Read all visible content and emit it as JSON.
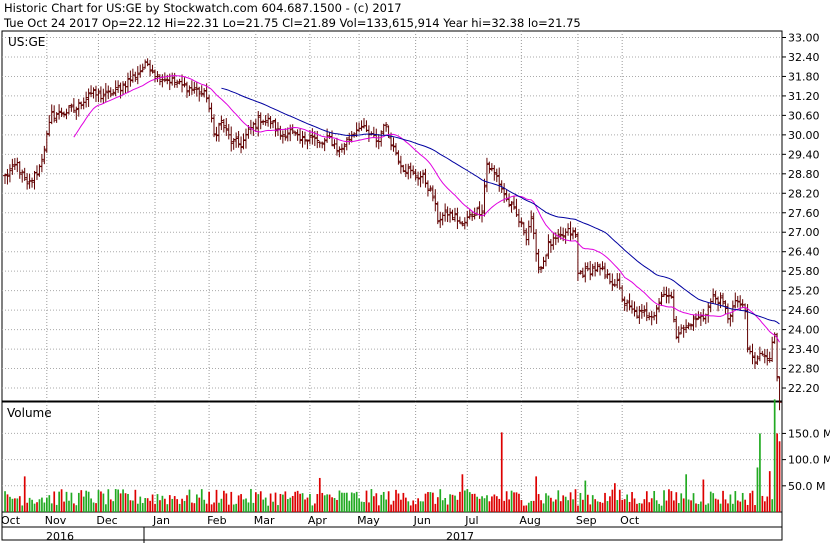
{
  "header": {
    "line1": "Historic Chart for US:GE by Stockwatch.com 604.687.1500 - (c) 2017",
    "line2": "Tue Oct 24 2017   Op=22.12   Hi=22.31   Lo=21.75   Cl=21.89   Vol=133,615,914   Year hi=32.38   lo=21.75"
  },
  "chart_data": {
    "type": "ohlc-bar",
    "symbol": "US:GE",
    "price_axis": {
      "min": 21.8,
      "max": 33.2,
      "ticks": [
        "33.00",
        "32.40",
        "31.80",
        "31.20",
        "30.60",
        "30.00",
        "29.40",
        "28.80",
        "28.20",
        "27.60",
        "27.00",
        "26.40",
        "25.80",
        "25.20",
        "24.60",
        "24.00",
        "23.40",
        "22.80",
        "22.20"
      ]
    },
    "volume_panel": {
      "label": "Volume",
      "ticks": [
        "150.0",
        "100.0",
        "50.0"
      ],
      "max_millions": 210
    },
    "months": [
      "Oct",
      "Nov",
      "Dec",
      "Jan",
      "Feb",
      "Mar",
      "Apr",
      "May",
      "Jun",
      "Jul",
      "Aug",
      "Sep",
      "Oct"
    ],
    "years": [
      "2016",
      "2017"
    ],
    "colors": {
      "ma_short": "#e000e0",
      "ma_long": "#0000a0",
      "bars": "#600000",
      "vol_up": "#22aa22",
      "vol_down": "#dd0000"
    },
    "close_anchors": [
      [
        0,
        28.7
      ],
      [
        5,
        29.1
      ],
      [
        9,
        28.4
      ],
      [
        14,
        29.0
      ],
      [
        19,
        30.6
      ],
      [
        24,
        30.7
      ],
      [
        29,
        30.8
      ],
      [
        34,
        31.3
      ],
      [
        39,
        31.2
      ],
      [
        44,
        31.3
      ],
      [
        49,
        31.6
      ],
      [
        54,
        31.9
      ],
      [
        58,
        32.2
      ],
      [
        62,
        31.8
      ],
      [
        67,
        31.7
      ],
      [
        72,
        31.5
      ],
      [
        77,
        31.4
      ],
      [
        82,
        31.2
      ],
      [
        85,
        30.0
      ],
      [
        88,
        30.4
      ],
      [
        92,
        29.8
      ],
      [
        96,
        29.7
      ],
      [
        100,
        30.2
      ],
      [
        104,
        30.5
      ],
      [
        108,
        30.4
      ],
      [
        112,
        30.0
      ],
      [
        116,
        30.1
      ],
      [
        120,
        29.8
      ],
      [
        124,
        30.0
      ],
      [
        128,
        29.7
      ],
      [
        132,
        29.9
      ],
      [
        136,
        29.5
      ],
      [
        140,
        29.9
      ],
      [
        144,
        30.3
      ],
      [
        148,
        30.0
      ],
      [
        152,
        29.8
      ],
      [
        154,
        30.4
      ],
      [
        158,
        29.6
      ],
      [
        162,
        29.0
      ],
      [
        166,
        28.8
      ],
      [
        170,
        28.7
      ],
      [
        174,
        28.1
      ],
      [
        176,
        27.4
      ],
      [
        180,
        27.6
      ],
      [
        184,
        27.4
      ],
      [
        186,
        27.2
      ],
      [
        190,
        27.6
      ],
      [
        194,
        27.7
      ],
      [
        196,
        29.1
      ],
      [
        200,
        28.7
      ],
      [
        204,
        28.0
      ],
      [
        208,
        27.5
      ],
      [
        212,
        26.9
      ],
      [
        214,
        27.5
      ],
      [
        216,
        26.2
      ],
      [
        218,
        25.9
      ],
      [
        221,
        26.6
      ],
      [
        225,
        26.8
      ],
      [
        229,
        27.0
      ],
      [
        232,
        26.9
      ],
      [
        233,
        25.7
      ],
      [
        237,
        25.8
      ],
      [
        241,
        25.9
      ],
      [
        245,
        25.6
      ],
      [
        249,
        25.4
      ],
      [
        252,
        24.8
      ],
      [
        256,
        24.5
      ],
      [
        260,
        24.5
      ],
      [
        264,
        24.5
      ],
      [
        268,
        25.2
      ],
      [
        271,
        24.9
      ],
      [
        273,
        23.9
      ],
      [
        276,
        24.0
      ],
      [
        280,
        24.3
      ],
      [
        284,
        24.4
      ],
      [
        288,
        25.0
      ],
      [
        291,
        24.9
      ],
      [
        294,
        24.4
      ],
      [
        298,
        24.9
      ],
      [
        301,
        24.5
      ],
      [
        302,
        23.4
      ],
      [
        305,
        23.0
      ],
      [
        308,
        23.3
      ],
      [
        311,
        23.2
      ],
      [
        313,
        23.8
      ],
      [
        314,
        22.6
      ],
      [
        315,
        21.9
      ]
    ],
    "volume_spikes": [
      [
        8,
        68
      ],
      [
        128,
        65
      ],
      [
        186,
        72
      ],
      [
        202,
        152
      ],
      [
        216,
        68
      ],
      [
        236,
        60
      ],
      [
        248,
        55
      ],
      [
        277,
        72
      ],
      [
        284,
        62
      ],
      [
        306,
        85
      ],
      [
        307,
        150
      ],
      [
        311,
        78
      ],
      [
        313,
        215
      ],
      [
        314,
        150
      ],
      [
        315,
        135
      ]
    ]
  }
}
